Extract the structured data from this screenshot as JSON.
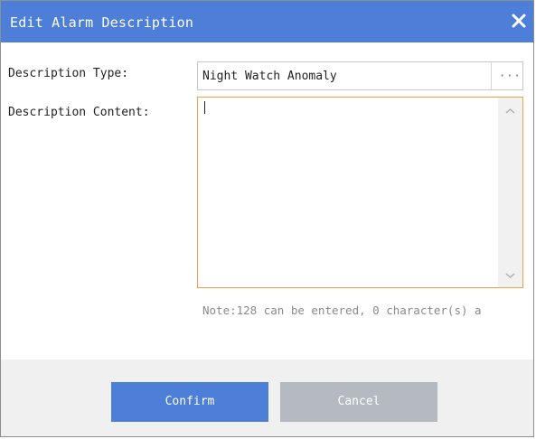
{
  "dialog": {
    "title": "Edit Alarm Description",
    "close_icon": "close-icon",
    "accent_color": "#4d7fd8"
  },
  "form": {
    "type_label": "Description Type:",
    "type_value": "Night Watch Anomaly",
    "browse_label": "···",
    "content_label": "Description Content:",
    "content_value": "",
    "focus_border_color": "#f2a34a"
  },
  "note": {
    "text": "Note:128 can be entered, 0 character(s) a"
  },
  "footer": {
    "confirm_label": "Confirm",
    "cancel_label": "Cancel",
    "cancel_color": "#b5bac1"
  }
}
